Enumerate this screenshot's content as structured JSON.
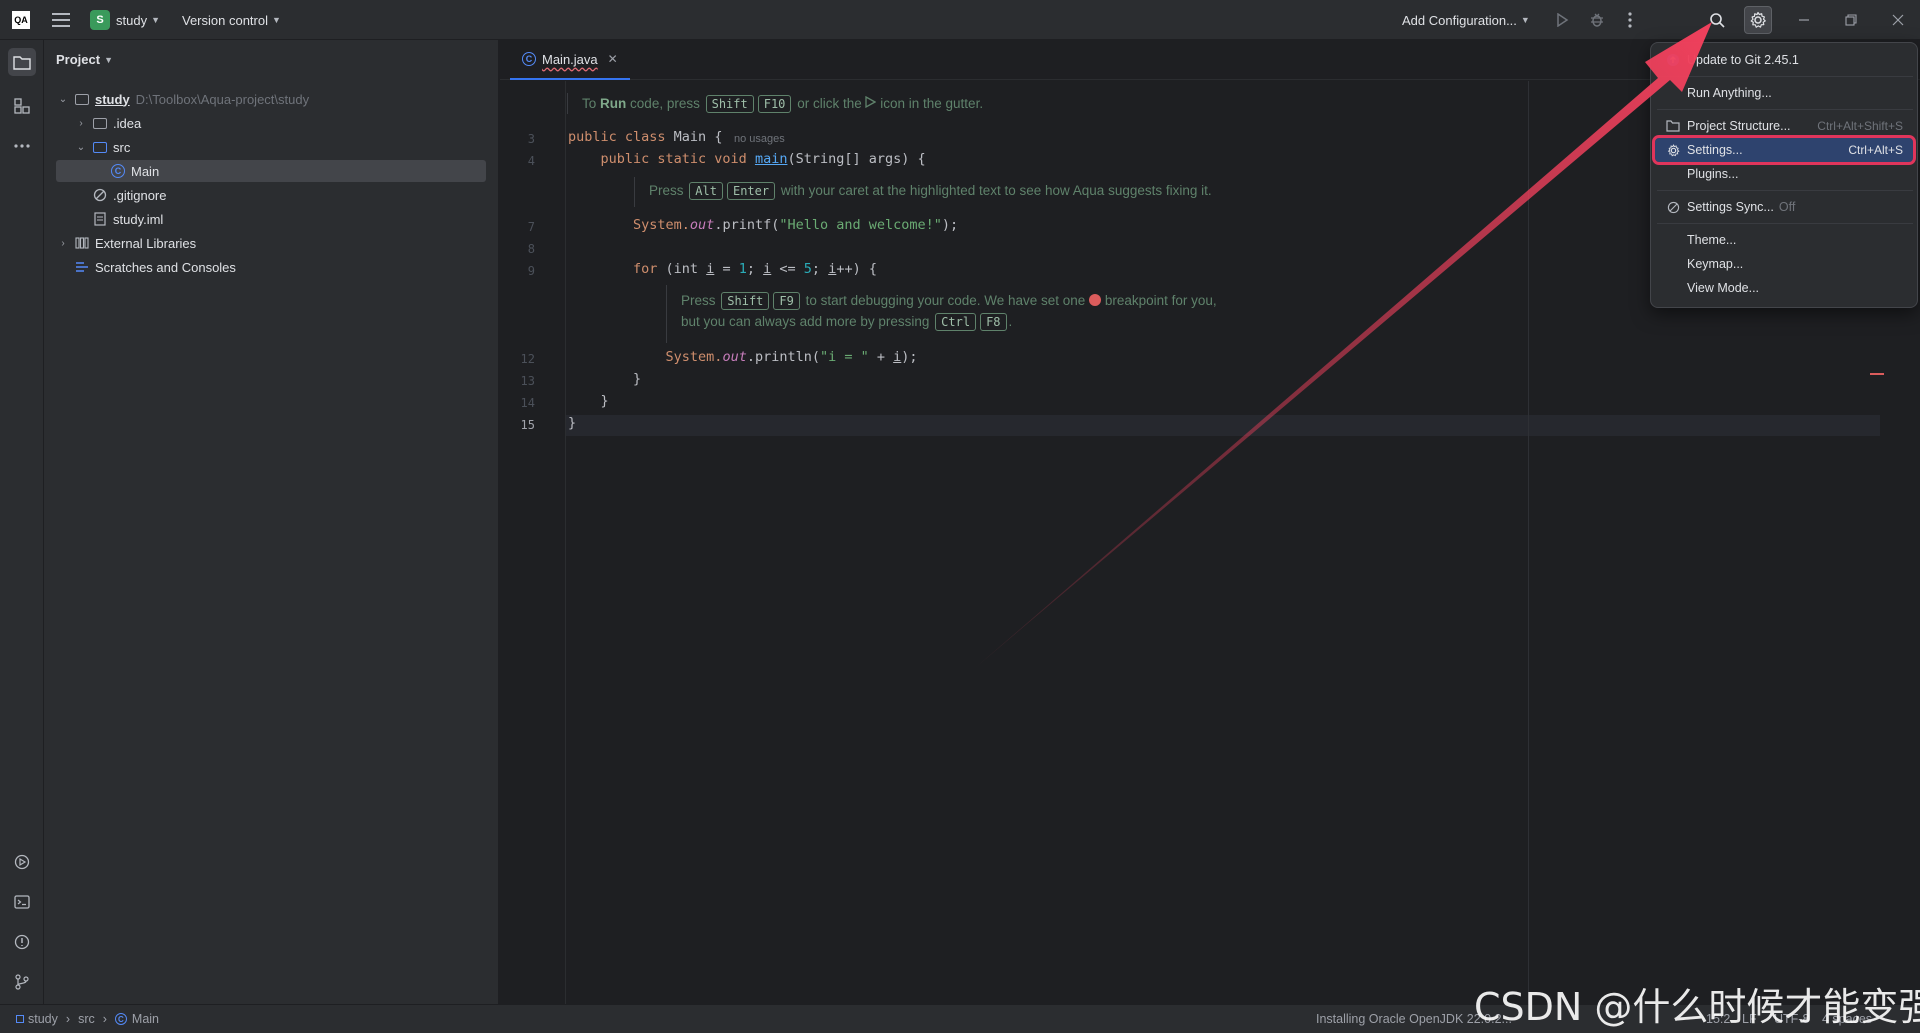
{
  "titlebar": {
    "app_logo": "QA",
    "project_badge": "S",
    "project_name": "study",
    "vcs": "Version control",
    "run_config": "Add Configuration..."
  },
  "project_panel": {
    "title": "Project",
    "tree": [
      {
        "label": "study",
        "path": "D:\\Toolbox\\Aqua-project\\study"
      },
      {
        "label": ".idea"
      },
      {
        "label": "src"
      },
      {
        "label": "Main"
      },
      {
        "label": ".gitignore"
      },
      {
        "label": "study.iml"
      },
      {
        "label": "External Libraries"
      },
      {
        "label": "Scratches and Consoles"
      }
    ]
  },
  "editor": {
    "tab_label": "Main.java",
    "run_hint": {
      "prefix": "To",
      "run": "Run",
      "mid": "code, press",
      "k1": "Shift",
      "k2": "F10",
      "suffix": "or click the",
      "end": "icon in the gutter."
    },
    "line_numbers": [
      "3",
      "4",
      "7",
      "8",
      "9",
      "12",
      "13",
      "14",
      "15"
    ],
    "inlay_usages": "no usages",
    "doc1": {
      "press": "Press",
      "k1": "Alt",
      "k2": "Enter",
      "text": "with your caret at the highlighted text to see how Aqua suggests fixing it."
    },
    "doc2": {
      "press": "Press",
      "k1": "Shift",
      "k2": "F9",
      "text1": "to start debugging your code. We have set one",
      "text2": "breakpoint for you,",
      "line2": "but you can always add more by pressing",
      "k3": "Ctrl",
      "k4": "F8",
      "end": "."
    },
    "code": {
      "l3a": "public class ",
      "l3b": "Main",
      "l3c": " {",
      "l4a": "    public static void ",
      "l4b": "main",
      "l4c": "(String[] args) {",
      "l7a": "        System.",
      "l7b": "out",
      "l7c": ".printf(",
      "l7d": "\"Hello and welcome!\"",
      "l7e": ");",
      "l9a": "        for ",
      "l9b": "(int ",
      "l9c": "i",
      "l9d": " = ",
      "l9e": "1",
      "l9f": "; ",
      "l9g": "i",
      "l9h": " <= ",
      "l9i": "5",
      "l9j": "; ",
      "l9k": "i",
      "l9l": "++) {",
      "l12a": "            System.",
      "l12b": "out",
      "l12c": ".println(",
      "l12d": "\"i = \"",
      "l12e": " + ",
      "l12f": "i",
      "l12g": ");",
      "l13": "        }",
      "l14": "    }",
      "l15": "}"
    }
  },
  "menu": {
    "items": [
      {
        "label": "Update to Git 2.45.1",
        "shortcut": ""
      },
      {
        "label": "Run Anything...",
        "shortcut": ""
      },
      {
        "label": "Project Structure...",
        "shortcut": "Ctrl+Alt+Shift+S"
      },
      {
        "label": "Settings...",
        "shortcut": "Ctrl+Alt+S"
      },
      {
        "label": "Plugins...",
        "shortcut": ""
      },
      {
        "label": "Settings Sync...",
        "shortcut": "Off"
      },
      {
        "label": "Theme...",
        "shortcut": ""
      },
      {
        "label": "Keymap...",
        "shortcut": ""
      },
      {
        "label": "View Mode...",
        "shortcut": ""
      }
    ]
  },
  "statusbar": {
    "crumb1": "study",
    "crumb2": "src",
    "crumb3": "Main",
    "progress": "Installing Oracle OpenJDK 22.0.2...",
    "position": "15:2",
    "line_sep": "LF",
    "encoding": "UTF-8",
    "indent": "4 spaces"
  },
  "watermark": "CSDN @什么时候才能变强",
  "colors": {
    "accent": "#3574f0",
    "highlight_box": "#e0355b",
    "arrow": "#f0405c"
  }
}
